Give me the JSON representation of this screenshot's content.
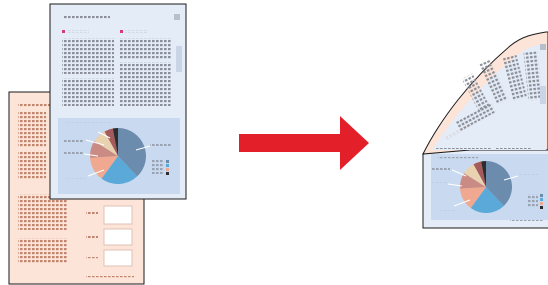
{
  "illustration": {
    "description_items": [
      "back-page-sheet",
      "front-page-sheet",
      "pie-chart",
      "direction-arrow",
      "folded-result-sheet"
    ],
    "colors": {
      "back_page_tint": "#fde4d8",
      "front_page_tint": "#e4ecf7",
      "chart_panel": "#c9daf0",
      "arrow_red": "#e3202a",
      "text_lines": "#8a8f99",
      "pink_marker": "#d63a7c",
      "outline": "#1a1a1a"
    },
    "pie_slice_colors": [
      "#6c8cae",
      "#5aa9d8",
      "#f0a890",
      "#c98b84",
      "#e9d2b0",
      "#a55b5b",
      "#2d2d2d"
    ],
    "pie_slice_values": [
      38,
      22,
      14,
      10,
      8,
      5,
      3
    ]
  }
}
